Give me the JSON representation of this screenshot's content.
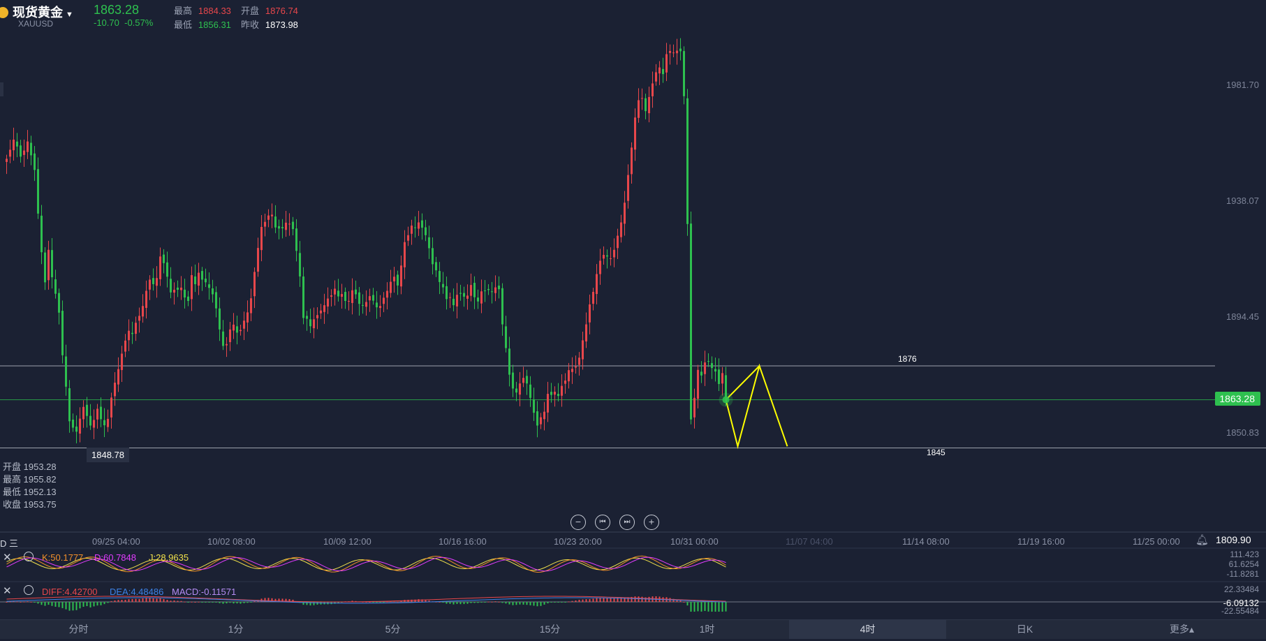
{
  "header": {
    "name": "现货黄金",
    "code": "XAUUSD",
    "price": "1863.28",
    "change": "-10.70",
    "change_pct": "-0.57%",
    "high_label": "最高",
    "high": "1884.33",
    "open_label": "开盘",
    "open": "1876.74",
    "low_label": "最低",
    "low": "1856.31",
    "prev_label": "昨收",
    "prev": "1873.98"
  },
  "colors": {
    "up": "#e8474b",
    "down": "#2ec04f",
    "bg": "#1b2133",
    "annotation": "#ffff00"
  },
  "y_ticks": [
    "1981.70",
    "1938.07",
    "1894.45",
    "1850.83"
  ],
  "current_price_tag": "1863.28",
  "low_marker": "1848.78",
  "hover_ohlc": [
    {
      "label": "开盘",
      "value": "1953.28"
    },
    {
      "label": "最高",
      "value": "1955.82"
    },
    {
      "label": "最低",
      "value": "1952.13"
    },
    {
      "label": "收盘",
      "value": "1953.75"
    }
  ],
  "annotations": {
    "target_high": "1876",
    "target_low": "1845"
  },
  "x_ticks": [
    "09/25 04:00",
    "10/02 08:00",
    "10/09 12:00",
    "10/16 16:00",
    "10/23 20:00",
    "10/31 00:00",
    "11/07 04:00",
    "11/14 08:00",
    "11/19 16:00",
    "11/25 00:00"
  ],
  "x_axis_right_value": "1809.90",
  "x_axis_left_glyph": "D 三",
  "kdj": {
    "k": "K:50.1777",
    "d": "D:60.7848",
    "j": "J:28.9635",
    "axis": [
      "111.423",
      "61.6254",
      "-11.8281"
    ]
  },
  "macd": {
    "diff": "DIFF:4.42700",
    "dea": "DEA:4.48486",
    "macd": "MACD:-0.11571",
    "axis": [
      "22.33484",
      "-6.09132",
      "-22.55484"
    ]
  },
  "tabs": [
    "分时",
    "1分",
    "5分",
    "15分",
    "1时",
    "4时",
    "日K",
    "更多▴"
  ],
  "active_tab": "4时",
  "chart_data": {
    "type": "candlestick",
    "title": "现货黄金 XAUUSD 4时",
    "y_range": [
      1845,
      2000
    ],
    "close": [
      1953.8,
      1957.2,
      1961.0,
      1958.4,
      1954.6,
      1956.9,
      1960.3,
      1955.1,
      1949.6,
      1933.2,
      1918.7,
      1907.4,
      1919.6,
      1909.3,
      1903.1,
      1896.0,
      1880.0,
      1868.2,
      1855.2,
      1852.8,
      1851.3,
      1856.2,
      1860.6,
      1857.2,
      1853.6,
      1855.7,
      1859.9,
      1856.0,
      1853.7,
      1856.1,
      1864.1,
      1869.7,
      1874.8,
      1880.6,
      1885.5,
      1889.2,
      1888.0,
      1892.2,
      1894.8,
      1898.5,
      1904.2,
      1908.4,
      1906.7,
      1909.0,
      1917.1,
      1914.6,
      1909.5,
      1903.6,
      1904.6,
      1904.6,
      1905.4,
      1901.7,
      1900.4,
      1910.1,
      1906.7,
      1911.0,
      1908.4,
      1907.4,
      1905.3,
      1902.9,
      1897.6,
      1889.7,
      1883.5,
      1884.2,
      1889.7,
      1891.5,
      1888.5,
      1889.5,
      1893.0,
      1896.1,
      1901.4,
      1911.3,
      1920.3,
      1928.2,
      1930.1,
      1932.5,
      1932.8,
      1928.0,
      1927.6,
      1927.7,
      1929.8,
      1929.4,
      1927.4,
      1919.2,
      1909.6,
      1894.0,
      1893.7,
      1890.9,
      1893.5,
      1895.1,
      1896.8,
      1898.8,
      1901.3,
      1902.5,
      1905.0,
      1902.1,
      1903.0,
      1900.4,
      1900.4,
      1904.4,
      1902.9,
      1899.3,
      1898.8,
      1900.0,
      1902.2,
      1900.5,
      1898.0,
      1898.5,
      1901.6,
      1904.2,
      1907.6,
      1909.5,
      1906.2,
      1913.7,
      1922.5,
      1925.1,
      1928.7,
      1927.9,
      1929.9,
      1927.9,
      1925.1,
      1920.2,
      1914.2,
      1911.9,
      1907.5,
      1905.5,
      1901.1,
      1901.8,
      1898.8,
      1902.7,
      1903.1,
      1902.0,
      1902.4,
      1906.4,
      1901.8,
      1900.2,
      1904.0,
      1904.2,
      1904.5,
      1903.9,
      1905.5,
      1904.8,
      1891.6,
      1882.7,
      1872.7,
      1867.5,
      1866.0,
      1869.4,
      1871.5,
      1869.4,
      1864.0,
      1858.4,
      1853.6,
      1856.7,
      1858.8,
      1865.5,
      1865.1,
      1866.3,
      1864.7,
      1868.5,
      1870.5,
      1874.4,
      1874.9,
      1875.8,
      1879.1,
      1885.6,
      1891.6,
      1899.1,
      1903.8,
      1910.5,
      1915.5,
      1917.7,
      1917.1,
      1916.4,
      1919.6,
      1924.9,
      1929.9,
      1937.3,
      1947.7,
      1958.0,
      1969.3,
      1975.8,
      1976.6,
      1971.7,
      1977.0,
      1982.1,
      1986.3,
      1988.1,
      1985.6,
      1993.1,
      1994.3,
      1993.7,
      1994.4,
      1994.2,
      1977.3,
      1929.3,
      1855.9,
      1864.0,
      1874.5,
      1872.4,
      1877.3,
      1877.7,
      1875.2,
      1873.9,
      1869.2,
      1873.3,
      1863.3
    ]
  }
}
